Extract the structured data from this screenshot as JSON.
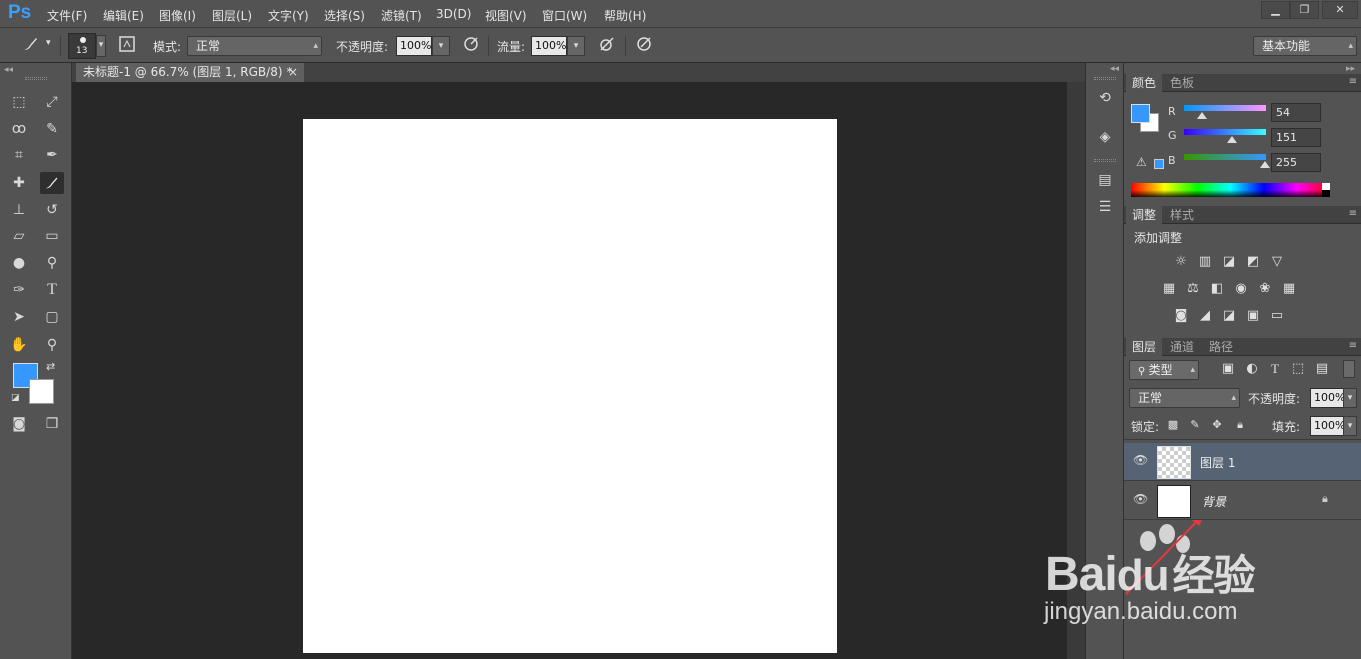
{
  "app": {
    "logo": "Ps"
  },
  "menu": [
    "文件(F)",
    "编辑(E)",
    "图像(I)",
    "图层(L)",
    "文字(Y)",
    "选择(S)",
    "滤镜(T)",
    "3D(D)",
    "视图(V)",
    "窗口(W)",
    "帮助(H)"
  ],
  "window_controls": {
    "minimize": "▁",
    "restore": "❐",
    "close": "✕"
  },
  "options": {
    "brush_size": "13",
    "mode_label": "模式:",
    "mode_value": "正常",
    "opacity_label": "不透明度:",
    "opacity_value": "100%",
    "flow_label": "流量:",
    "flow_value": "100%",
    "workspace": "基本功能"
  },
  "document_tab": {
    "title": "未标题-1 @ 66.7% (图层 1, RGB/8) *",
    "close": "×"
  },
  "colors": {
    "foreground": "#3697ff",
    "background": "#ffffff"
  },
  "color_panel": {
    "tabs": [
      "颜色",
      "色板"
    ],
    "r_label": "R",
    "r_value": "54",
    "g_label": "G",
    "g_value": "151",
    "b_label": "B",
    "b_value": "255"
  },
  "adjust_panel": {
    "tabs": [
      "调整",
      "样式"
    ],
    "title": "添加调整"
  },
  "layers_panel": {
    "tabs": [
      "图层",
      "通道",
      "路径"
    ],
    "filter_value": "类型",
    "blend_mode": "正常",
    "opacity_label": "不透明度:",
    "opacity_value": "100%",
    "lock_label": "锁定:",
    "fill_label": "填充:",
    "fill_value": "100%",
    "layers": [
      {
        "name": "图层 1",
        "selected": true
      },
      {
        "name": "背景",
        "selected": false
      }
    ]
  },
  "watermark": {
    "brand": "Bai",
    "brand2": "du",
    "suffix": "经验",
    "url": "jingyan.baidu.com"
  }
}
